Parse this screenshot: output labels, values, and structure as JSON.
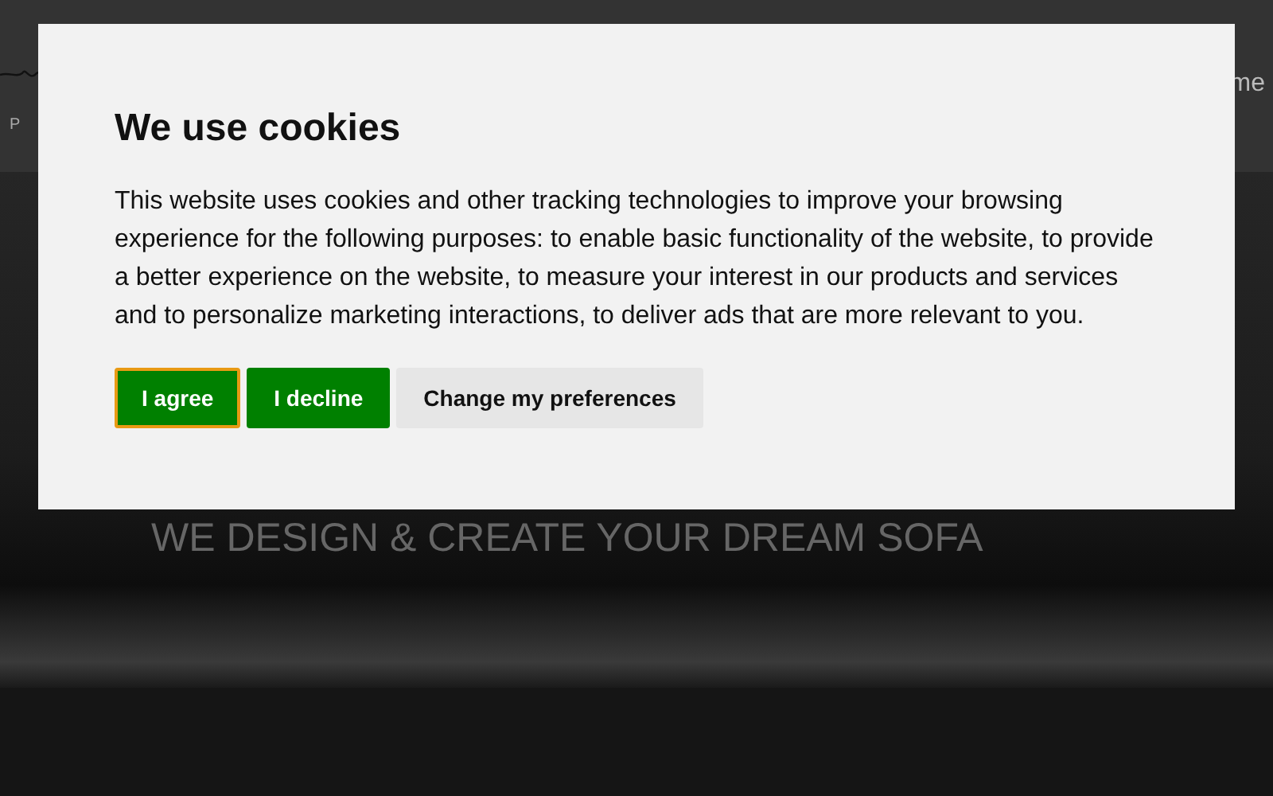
{
  "header": {
    "logo_letter": "P",
    "nav_item": "me"
  },
  "hero": {
    "subtitle": "WE DESIGN & CREATE YOUR DREAM SOFA"
  },
  "cookie_dialog": {
    "title": "We use cookies",
    "text": "This website uses cookies and other tracking technologies to improve your browsing experience for the following purposes: to enable basic functionality of the website, to provide a better experience on the website, to measure your interest in our products and services and to personalize marketing interactions, to deliver ads that are more relevant to you.",
    "buttons": [
      {
        "label": "I agree",
        "kind": "primary",
        "focused": true
      },
      {
        "label": "I decline",
        "kind": "primary",
        "focused": false
      },
      {
        "label": "Change my preferences",
        "kind": "secondary",
        "focused": false
      }
    ]
  }
}
